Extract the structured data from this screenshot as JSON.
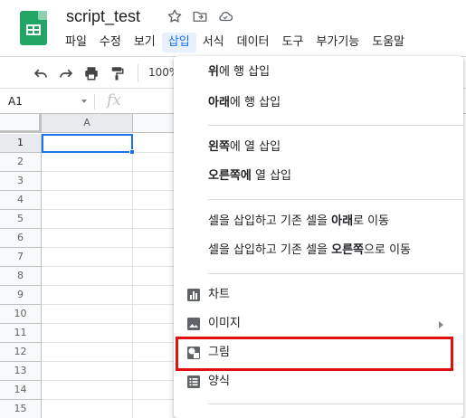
{
  "document": {
    "title": "script_test",
    "title_icons": [
      "star-icon",
      "move-to-folder-icon",
      "cloud-status-icon"
    ]
  },
  "menubar": [
    {
      "label": "파일",
      "active": false
    },
    {
      "label": "수정",
      "active": false
    },
    {
      "label": "보기",
      "active": false
    },
    {
      "label": "삽입",
      "active": true
    },
    {
      "label": "서식",
      "active": false
    },
    {
      "label": "데이터",
      "active": false
    },
    {
      "label": "도구",
      "active": false
    },
    {
      "label": "부가기능",
      "active": false
    },
    {
      "label": "도움말",
      "active": false
    }
  ],
  "toolbar": {
    "icons": [
      "undo-icon",
      "redo-icon",
      "print-icon",
      "paint-format-icon"
    ],
    "zoom": "100%"
  },
  "formula_bar": {
    "cell_ref": "A1",
    "fx_label": "fx"
  },
  "grid": {
    "columns": [
      "A"
    ],
    "rows": [
      "1",
      "2",
      "3",
      "4",
      "5",
      "6",
      "7",
      "8",
      "9",
      "10",
      "11",
      "12",
      "13",
      "14",
      "15"
    ],
    "selected_cell": "A1"
  },
  "insert_menu": {
    "items": [
      {
        "strong": "위",
        "rest": "에 행 삽입"
      },
      {
        "strong": "아래",
        "rest": "에 행 삽입"
      },
      {
        "strong": "왼쪽",
        "rest": "에 열 삽입"
      },
      {
        "strong": "오른쪽에",
        "rest": " 열 삽입"
      },
      {
        "pre": "셀을 삽입하고 기존 셀을 ",
        "strong": "아래",
        "rest": "로 이동"
      },
      {
        "pre": "셀을 삽입하고 기존 셀을 ",
        "strong": "오른쪽",
        "rest": "으로 이동"
      },
      {
        "label": "차트",
        "icon": "chart-icon"
      },
      {
        "label": "이미지",
        "icon": "image-icon",
        "submenu": true
      },
      {
        "label": "그림",
        "icon": "drawing-icon",
        "highlighted": true
      },
      {
        "label": "양식",
        "icon": "form-icon"
      }
    ]
  },
  "colors": {
    "accent": "#1a73e8",
    "sheets_green": "#23a566",
    "highlight_border": "#e01010"
  }
}
